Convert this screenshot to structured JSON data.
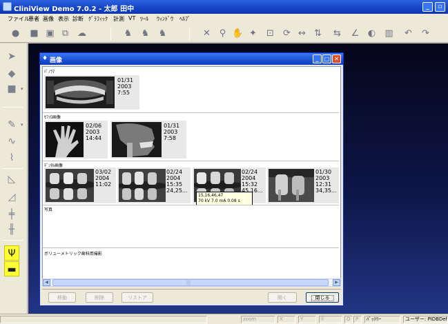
{
  "app": {
    "title": "CliniView Demo 7.0.2 - 太郎 田中"
  },
  "menu": [
    "ファイル",
    "患者",
    "画像",
    "表示",
    "診断",
    "ｸﾞﾗﾌｨｯｸ",
    "計測",
    "VT",
    "ﾂｰﾙ",
    "ｳｨﾝﾄﾞｳ",
    "ﾍﾙﾌﾟ"
  ],
  "dialog": {
    "title": "画像",
    "sections": {
      "panorama": {
        "label": "ﾊﾟﾉﾗﾏ"
      },
      "ceph": {
        "label": "ｾﾌｧﾛ画像"
      },
      "intraoral": {
        "label": "ﾃﾞﾝﾀﾙ画像"
      },
      "photo": {
        "label": "写真"
      },
      "volumetric": {
        "label": "ボリューメトリック歯科用撮影"
      }
    },
    "images": {
      "pan1": {
        "date": "01/31",
        "year": "2003",
        "time": "7:55"
      },
      "ceph1": {
        "date": "02/06",
        "year": "2003",
        "time": "14:44"
      },
      "ceph2": {
        "date": "01/31",
        "year": "2003",
        "time": "7:58"
      },
      "intra1": {
        "date": "03/02",
        "year": "2004",
        "time": "11:02"
      },
      "intra2": {
        "date": "02/24",
        "year": "2004",
        "time": "15:35",
        "teeth": "24,25..."
      },
      "intra3": {
        "date": "02/24",
        "year": "2004",
        "time": "15:32",
        "teeth": "45,16..."
      },
      "intra4": {
        "date": "01/30",
        "year": "2003",
        "time": "12:31",
        "teeth": "34,35..."
      }
    },
    "tooltip": {
      "line1": "15,16,46,47",
      "line2": "70 kV 7.0 mA 0.08 s"
    },
    "buttons": {
      "move": "移動",
      "delete": "削除",
      "restore": "リストア",
      "open": "開く",
      "close": "閉じる"
    }
  },
  "status": {
    "zoom": "zoom",
    "x": "X",
    "y": "Y",
    "v": "ll",
    "o": "O",
    "p": "P",
    "battery": "ﾊﾞｯﾃﾘｰ",
    "user": "ユーザー: PIDBDefau"
  },
  "colors": {
    "titlebar": "#1848c8",
    "workspace": "#0d1648",
    "highlight_tool": "#ffff33"
  },
  "icons": {
    "toolbar": [
      "tooth-icon",
      "camera-icon",
      "save-icon",
      "export-icon",
      "cloud-icon",
      "tooth-select-icon",
      "tooth-group-icon",
      "tooth-chart-icon",
      "cross-icon",
      "zoom-icon",
      "hand-icon",
      "magic-icon",
      "crop-icon",
      "rotate-icon",
      "measure-icon",
      "flip-icon",
      "mirror-icon",
      "angle-icon",
      "contrast-icon",
      "histogram-icon",
      "undo-icon",
      "redo-icon"
    ],
    "left": [
      "pointer-icon",
      "eraser-icon",
      "color-fill-icon",
      "freehand-icon",
      "curve-icon",
      "polyline-icon",
      "triangle-icon",
      "triangle-ruler-icon",
      "implant-icon",
      "bridge-icon",
      "implant-tool-icon",
      "sensor-icon"
    ]
  }
}
